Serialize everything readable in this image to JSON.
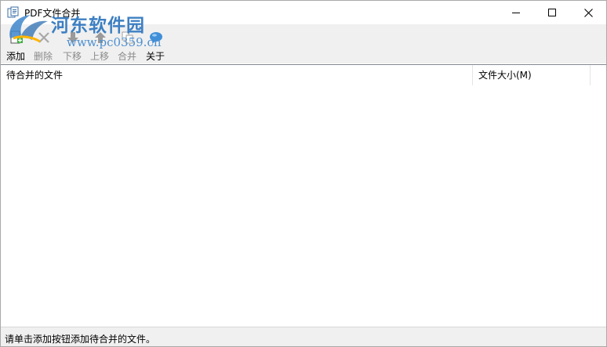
{
  "window": {
    "title": "PDF文件合并"
  },
  "watermark": {
    "name": "河东软件园",
    "url": "www.pc0359.cn"
  },
  "toolbar": {
    "add_label": "添加",
    "delete_label": "删除",
    "down_label": "下移",
    "up_label": "上移",
    "merge_label": "合并",
    "about_label": "关于"
  },
  "list": {
    "columns": [
      "待合并的文件",
      "文件大小(M)"
    ]
  },
  "status": {
    "text": "请单击添加按钮添加待合并的文件。"
  },
  "colors": {
    "watermark_blue": "#3d7fc2",
    "toolbar_bg": "#f0f0f0",
    "disabled_text": "#8a8a8a"
  }
}
